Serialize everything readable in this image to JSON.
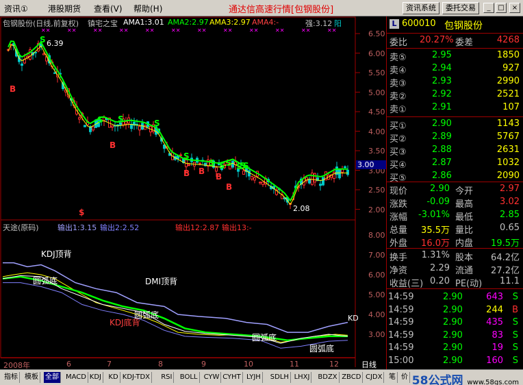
{
  "menu": {
    "items": [
      "资讯①",
      "港股期货",
      "查看(V)",
      "帮助(H)"
    ]
  },
  "app_title": "通达信高速行情[包钢股份]",
  "toolbar": {
    "info_system": "资讯系统",
    "delegate": "委托交易"
  },
  "window": {
    "min": "_",
    "restore": "□",
    "close": "×"
  },
  "main_chart": {
    "header": {
      "title": "包钢股份(日线,前复权)",
      "indicator": "镇宅之宝",
      "ama1": "AMA1:3.01",
      "ama2": "AMA2:2.97",
      "ama3": "AMA3:2.97",
      "ama4": "AMA4:-",
      "strength": "强:3.12",
      "yang": "阳"
    },
    "y_ticks": [
      "6.50",
      "6.00",
      "5.50",
      "5.00",
      "4.50",
      "4.00",
      "3.50",
      "3.00",
      "2.50",
      "2.00"
    ],
    "current_price_tag": "3.00",
    "high_label": "6.39",
    "low_label": "2.08",
    "signals": [
      "B",
      "S",
      "S",
      "S",
      "B",
      "S",
      "S",
      "S",
      "B",
      "S",
      "S",
      "B",
      "B",
      "B",
      "S",
      "S",
      "S",
      "$"
    ],
    "colors": {
      "up": "#ff3030",
      "down": "#00c8c8",
      "ama": "#00ff00",
      "yellow": "#ffff00",
      "purple": "#ff00ff"
    }
  },
  "sub_chart": {
    "header": {
      "name": "天途(原码)",
      "out1": "输出1:3.15",
      "out2": "输出2:2.52",
      "out12": "输出12:2.87",
      "out13": "输出13:-"
    },
    "y_ticks": [
      "8.00",
      "7.00",
      "6.00",
      "5.00",
      "4.00",
      "3.00"
    ],
    "annotations": [
      "KDJ顶背",
      "DMI顶背",
      "圆弧底",
      "圆弧底",
      "圆弧底",
      "圆弧底",
      "KDJ底背",
      "KD"
    ]
  },
  "x_axis": {
    "labels": [
      "2008年",
      "6",
      "7",
      "8",
      "9",
      "10",
      "11",
      "12"
    ],
    "period": "日线"
  },
  "quote": {
    "code": "600010",
    "name": "包钢股份",
    "weibi_label": "委比",
    "weibi": "20.27%",
    "weicha_label": "委差",
    "weicha": "4268",
    "sells": [
      {
        "label": "卖⑤",
        "price": "2.95",
        "vol": "1850"
      },
      {
        "label": "卖④",
        "price": "2.94",
        "vol": "927"
      },
      {
        "label": "卖③",
        "price": "2.93",
        "vol": "2990"
      },
      {
        "label": "卖②",
        "price": "2.92",
        "vol": "2521"
      },
      {
        "label": "卖①",
        "price": "2.91",
        "vol": "107"
      }
    ],
    "buys": [
      {
        "label": "买①",
        "price": "2.90",
        "vol": "1143"
      },
      {
        "label": "买②",
        "price": "2.89",
        "vol": "5767"
      },
      {
        "label": "买③",
        "price": "2.88",
        "vol": "2631"
      },
      {
        "label": "买④",
        "price": "2.87",
        "vol": "1032"
      },
      {
        "label": "买⑤",
        "price": "2.86",
        "vol": "2090"
      }
    ],
    "stats": [
      {
        "l1": "现价",
        "v1": "2.90",
        "l2": "今开",
        "v2": "2.97"
      },
      {
        "l1": "涨跌",
        "v1": "-0.09",
        "l2": "最高",
        "v2": "3.02"
      },
      {
        "l1": "涨幅",
        "v1": "-3.01%",
        "l2": "最低",
        "v2": "2.85"
      },
      {
        "l1": "总量",
        "v1": "35.5万",
        "l2": "量比",
        "v2": "0.65"
      },
      {
        "l1": "外盘",
        "v1": "16.0万",
        "l2": "内盘",
        "v2": "19.5万"
      }
    ],
    "fundamentals": [
      {
        "l1": "换手",
        "v1": "1.31%",
        "l2": "股本",
        "v2": "64.2亿"
      },
      {
        "l1": "净资",
        "v1": "2.29",
        "l2": "流通",
        "v2": "27.2亿"
      },
      {
        "l1": "收益(三)",
        "v1": "0.20",
        "l2": "PE(动)",
        "v2": "11.1"
      }
    ],
    "ticks": [
      {
        "time": "14:59",
        "price": "2.90",
        "vol": "643",
        "side": "S"
      },
      {
        "time": "14:59",
        "price": "2.90",
        "vol": "244",
        "side": "B"
      },
      {
        "time": "14:59",
        "price": "2.90",
        "vol": "435",
        "side": "S"
      },
      {
        "time": "14:59",
        "price": "2.90",
        "vol": "83",
        "side": "S"
      },
      {
        "time": "14:59",
        "price": "2.90",
        "vol": "19",
        "side": "S"
      },
      {
        "time": "15:00",
        "price": "2.90",
        "vol": "160",
        "side": "S"
      }
    ]
  },
  "bottom_tabs": [
    "指标",
    "模板",
    "全部",
    "MACD",
    "KDJ",
    "KD",
    "KDJ-TDX",
    "RSI",
    "BOLL",
    "CYW",
    "CYHT",
    "LYJH",
    "SDLH",
    "LHXJ",
    "BDZX",
    "ZBCD",
    "CJDX"
  ],
  "right_tabs": [
    "笔",
    "价"
  ],
  "watermark": {
    "brand": "58公式网",
    "url": "www.58gs.com"
  }
}
